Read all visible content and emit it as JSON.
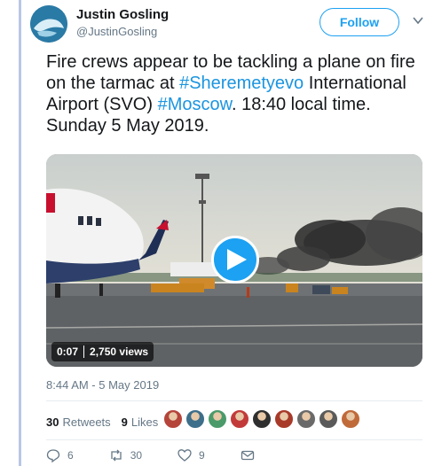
{
  "author": {
    "name": "Justin Gosling",
    "handle": "@JustinGosling"
  },
  "follow_label": "Follow",
  "tweet": {
    "part1": "Fire crews appear to be tackling a plane on fire on the tarmac at ",
    "hashtag1": "#Sheremetyevo",
    "part2": " International Airport (SVO) ",
    "hashtag2": "#Moscow",
    "part3": ". 18:40 local time. Sunday 5 May 2019."
  },
  "video": {
    "duration": "0:07",
    "views": "2,750 views"
  },
  "timestamp": "8:44 AM - 5 May 2019",
  "stats": {
    "retweets_count": "30",
    "retweets_label": "Retweets",
    "likes_count": "9",
    "likes_label": "Likes"
  },
  "likers": [
    "#b5443a",
    "#3d6e8a",
    "#4a9a6a",
    "#c23a3a",
    "#2f2f2f",
    "#a83a2a",
    "#6a6a6a",
    "#5a5a5a",
    "#c06a3a"
  ],
  "actions": {
    "replies": "6",
    "retweets": "30",
    "likes": "9"
  },
  "colors": {
    "accent": "#1da1f2",
    "hashtag": "#1b95e0",
    "muted": "#657786"
  }
}
